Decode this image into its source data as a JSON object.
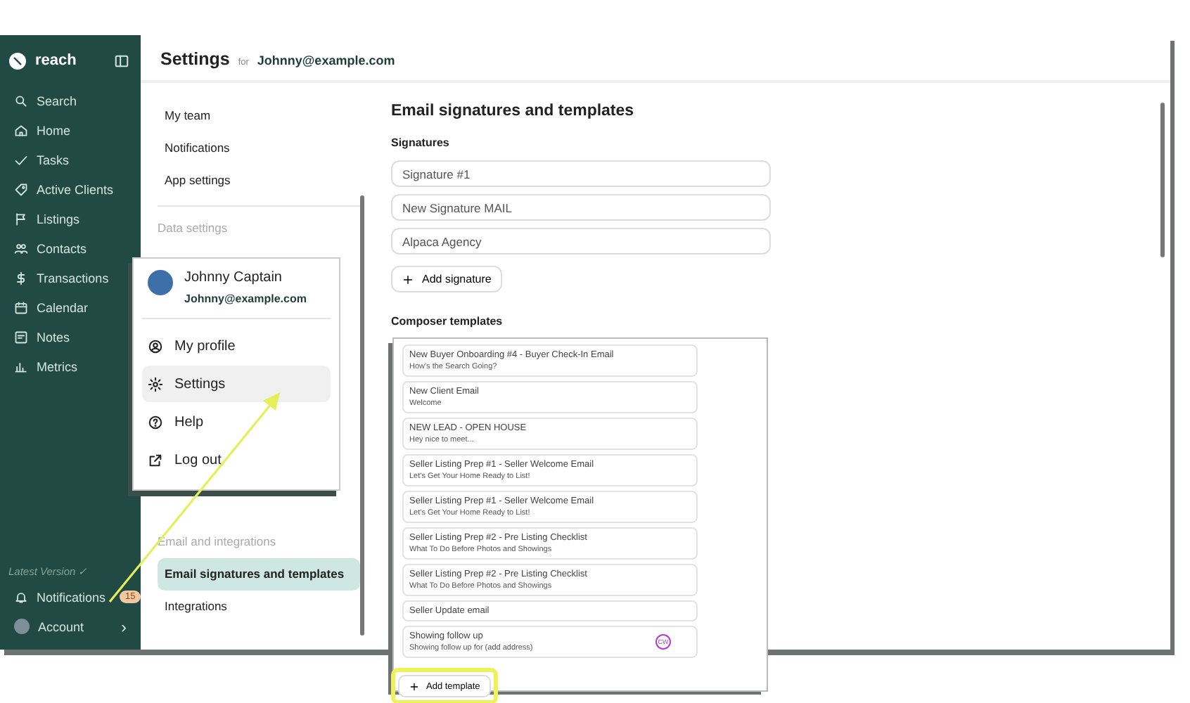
{
  "sidebar": {
    "logo": "reach",
    "items": [
      {
        "label": "Search"
      },
      {
        "label": "Home"
      },
      {
        "label": "Tasks"
      },
      {
        "label": "Active Clients"
      },
      {
        "label": "Listings"
      },
      {
        "label": "Contacts"
      },
      {
        "label": "Transactions"
      },
      {
        "label": "Calendar"
      },
      {
        "label": "Notes"
      },
      {
        "label": "Metrics"
      }
    ],
    "version": "Latest Version ✓",
    "notifications": {
      "label": "Notifications",
      "badge": "15"
    },
    "account": {
      "label": "Account",
      "chevron": "›"
    }
  },
  "header": {
    "title": "Settings",
    "for": "for",
    "email": "Johnny@example.com"
  },
  "settings_nav": {
    "items": [
      {
        "kind": "item",
        "label": "My team",
        "selected": false
      },
      {
        "kind": "item",
        "label": "Notifications",
        "selected": false
      },
      {
        "kind": "item",
        "label": "App settings",
        "selected": false
      },
      {
        "kind": "section",
        "label": "Data settings"
      },
      {
        "kind": "section",
        "label": "Email and integrations"
      },
      {
        "kind": "item",
        "label": "Email signatures and templates",
        "selected": true
      },
      {
        "kind": "item",
        "label": "Integrations",
        "selected": false
      }
    ]
  },
  "content": {
    "title": "Email signatures and templates",
    "signatures_heading": "Signatures",
    "signatures": [
      {
        "value": "Signature #1"
      },
      {
        "value": "New Signature MAIL"
      },
      {
        "value": "Alpaca Agency"
      }
    ],
    "add_signature": "Add signature",
    "templates_heading": "Composer templates"
  },
  "templates_panel": {
    "templates": [
      {
        "title": "New Buyer Onboarding #4 - Buyer Check-In Email",
        "subtitle": "How's the Search Going?"
      },
      {
        "title": "New Client Email",
        "subtitle": "Welcome"
      },
      {
        "title": "NEW LEAD - OPEN HOUSE",
        "subtitle": "Hey nice to meet..."
      },
      {
        "title": "Seller Listing Prep #1 - Seller Welcome Email",
        "subtitle": "Let's Get Your Home Ready to List!"
      },
      {
        "title": "Seller Listing Prep #1 - Seller Welcome Email",
        "subtitle": "Let's Get Your Home Ready to List!"
      },
      {
        "title": "Seller Listing Prep #2 - Pre Listing Checklist",
        "subtitle": "What To Do Before Photos and Showings"
      },
      {
        "title": "Seller Listing Prep #2 - Pre Listing Checklist",
        "subtitle": "What To Do Before Photos and Showings"
      },
      {
        "title": "Seller Update email"
      },
      {
        "title": "Showing follow up",
        "subtitle": "Showing follow up for (add address)",
        "badge": "CW"
      }
    ],
    "add_template": "Add template"
  },
  "profile_menu": {
    "name": "Johnny Captain",
    "email": "Johnny@example.com",
    "items": [
      {
        "label": "My profile",
        "selected": false
      },
      {
        "label": "Settings",
        "selected": true
      },
      {
        "label": "Help",
        "selected": false
      },
      {
        "label": "Log out",
        "selected": false
      }
    ]
  }
}
